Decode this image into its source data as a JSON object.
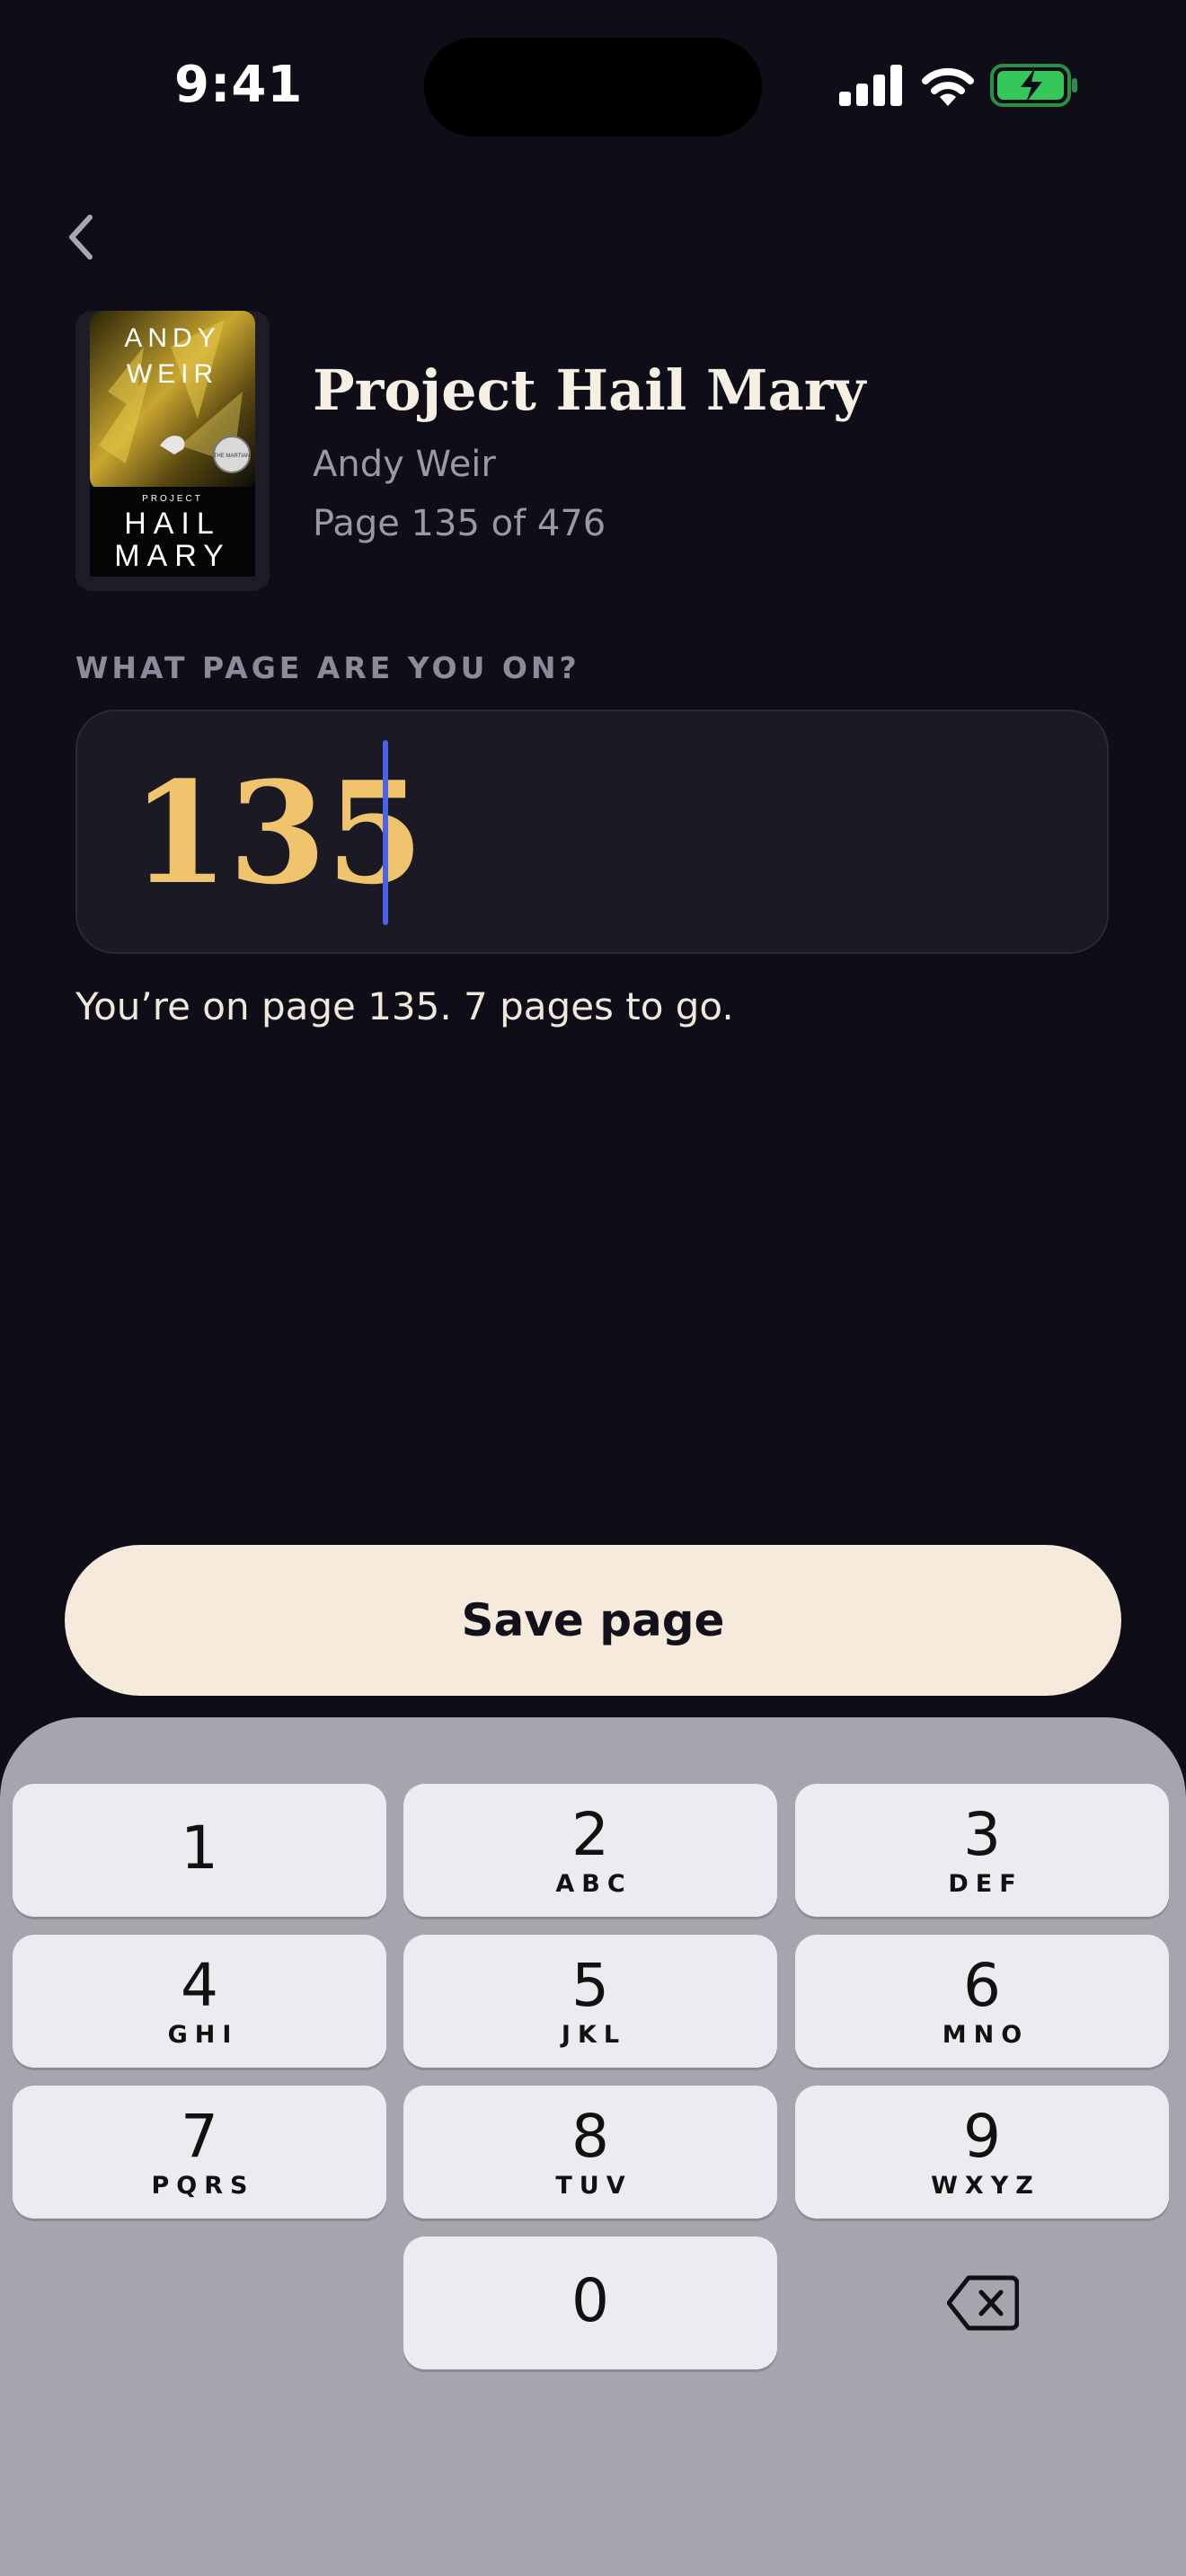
{
  "status_bar": {
    "time": "9:41"
  },
  "book": {
    "title": "Project Hail Mary",
    "author": "Andy Weir",
    "progress": "Page 135 of 476",
    "cover": {
      "author_line1": "ANDY",
      "author_line2": "WEIR",
      "small": "PROJECT",
      "title_line1": "HAIL",
      "title_line2": "MARY",
      "badge": "THE MARTIAN"
    }
  },
  "page_input": {
    "prompt": "WHAT PAGE ARE YOU ON?",
    "value": "135",
    "helper": "You’re on page 135. 7 pages to go."
  },
  "save_label": "Save page",
  "keypad": {
    "keys": [
      {
        "digit": "1",
        "letters": ""
      },
      {
        "digit": "2",
        "letters": "ABC"
      },
      {
        "digit": "3",
        "letters": "DEF"
      },
      {
        "digit": "4",
        "letters": "GHI"
      },
      {
        "digit": "5",
        "letters": "JKL"
      },
      {
        "digit": "6",
        "letters": "MNO"
      },
      {
        "digit": "7",
        "letters": "PQRS"
      },
      {
        "digit": "8",
        "letters": "TUV"
      },
      {
        "digit": "9",
        "letters": "WXYZ"
      },
      {
        "digit": "0",
        "letters": ""
      }
    ],
    "delete_icon": "backspace-icon"
  },
  "colors": {
    "background": "#0f0d17",
    "accent": "#f0c46c",
    "caret": "#4a63e6",
    "button": "#f5eadb",
    "battery": "#34c759"
  }
}
